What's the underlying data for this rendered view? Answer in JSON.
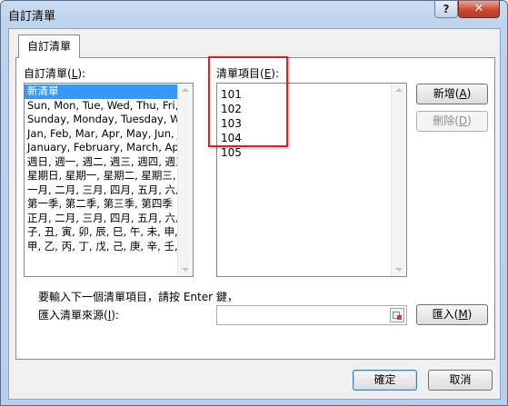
{
  "window": {
    "title": "自訂清單",
    "help_label": "?",
    "close_label": "✕"
  },
  "tab": {
    "label": "自訂清單"
  },
  "custom_lists": {
    "label_prefix": "自訂清單(",
    "label_key": "L",
    "label_suffix": "):",
    "items": [
      "新清單",
      "Sun, Mon, Tue, Wed, Thu, Fri, Sa",
      "Sunday, Monday, Tuesday, Wed",
      "Jan, Feb, Mar, Apr, May, Jun, Jul,",
      "January, February, March, April, I",
      "週日, 週一, 週二, 週三, 週四, 週五,",
      "星期日, 星期一, 星期二, 星期三, 星",
      "一月, 二月, 三月, 四月, 五月, 六月,",
      "第一季, 第二季, 第三季, 第四季",
      "正月, 二月, 三月, 四月, 五月, 六月,",
      "子, 丑, 寅, 卯, 辰, 巳, 午, 未, 申, 酉,",
      "甲, 乙, 丙, 丁, 戊, 己, 庚, 辛, 壬, 癸"
    ],
    "selected_index": 0
  },
  "list_entries": {
    "label_prefix": "清單項目(",
    "label_key": "E",
    "label_suffix": "):",
    "items": [
      "101",
      "102",
      "103",
      "104",
      "105"
    ]
  },
  "buttons": {
    "add_prefix": "新增(",
    "add_key": "A",
    "add_suffix": ")",
    "delete_prefix": "刪除(",
    "delete_key": "D",
    "delete_suffix": ")",
    "import_prefix": "匯入(",
    "import_key": "M",
    "import_suffix": ")",
    "ok": "確定",
    "cancel": "取消"
  },
  "hint": {
    "text": "要輸入下一個清單項目，請按 Enter 鍵，"
  },
  "import_source": {
    "label_prefix": "匯入清單來源(",
    "label_key": "I",
    "label_suffix": "):",
    "value": "",
    "picker_icon": "range-select-icon"
  },
  "colors": {
    "selection": "#3399ff",
    "highlight_box": "#e02020"
  }
}
